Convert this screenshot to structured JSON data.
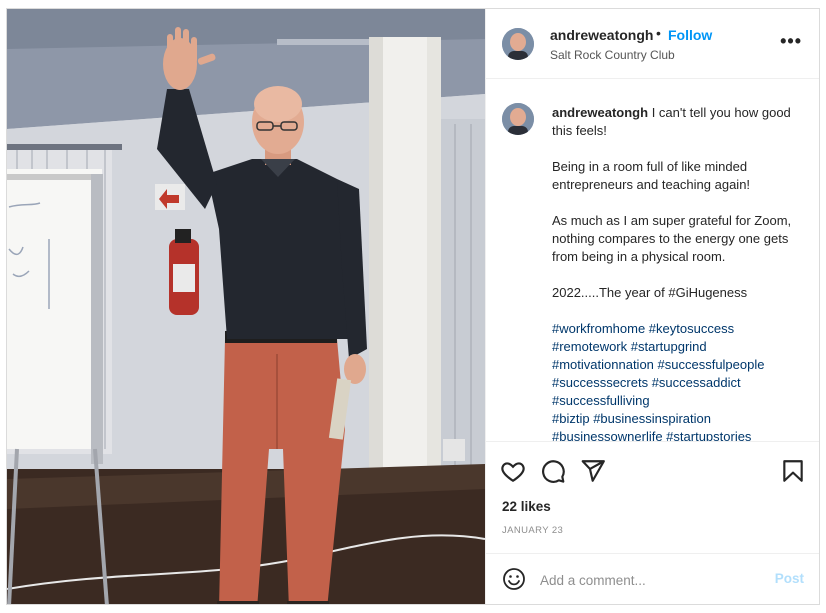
{
  "post": {
    "username": "andreweatongh",
    "separator": "•",
    "follow_label": "Follow",
    "location": "Salt Rock Country Club",
    "more_label": "•••",
    "caption_user": "andreweatongh",
    "caption_lines": [
      "I can't tell you how good this feels!",
      "Being in a room full of like minded entrepreneurs and teaching again!",
      "As much as I am super grateful for Zoom, nothing compares to the energy one gets from being in a physical room.",
      "2022.....The year of #GiHugeness"
    ],
    "hashtags": [
      "#workfromhome #keytosuccess",
      "#remotework #startupgrind",
      "#motivationnation #successfulpeople",
      "#successsecrets #successaddict",
      "#successfulliving",
      "#biztip #businessinspiration",
      "#businessownerlife #startupstories"
    ],
    "likes": "22 likes",
    "date": "JANUARY 23",
    "comment_placeholder": "Add a comment...",
    "post_label": "Post"
  },
  "icons": {
    "like": "heart-icon",
    "comment": "comment-icon",
    "share": "share-icon",
    "save": "bookmark-icon",
    "emoji": "emoji-icon",
    "more": "more-options-icon"
  },
  "colors": {
    "follow": "#0095f6",
    "hashtag": "#00376b",
    "post_disabled": "#b2dffc",
    "muted": "#8e8e8e"
  }
}
